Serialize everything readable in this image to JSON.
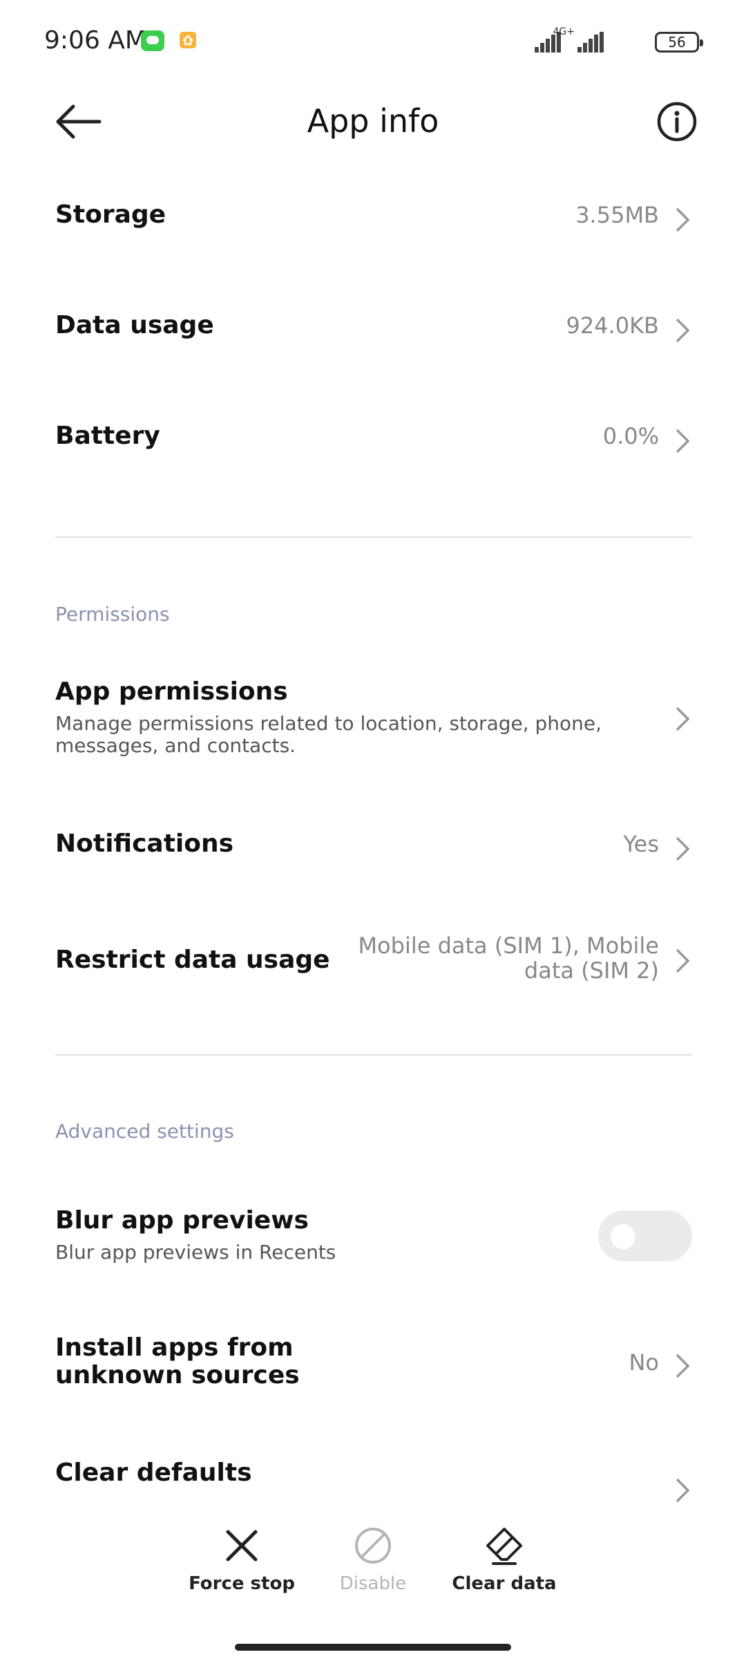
{
  "status_bar": {
    "time": "9:06 AM",
    "network_type": "4G+",
    "battery_level": "56"
  },
  "header": {
    "title": "App info"
  },
  "rows_top": [
    {
      "label": "Storage",
      "value": "3.55MB"
    },
    {
      "label": "Data usage",
      "value": "924.0KB"
    },
    {
      "label": "Battery",
      "value": "0.0%"
    }
  ],
  "permissions": {
    "section_title": "Permissions",
    "app_permissions": {
      "label": "App permissions",
      "description": "Manage permissions related to location, storage, phone, messages, and contacts."
    },
    "notifications": {
      "label": "Notifications",
      "value": "Yes"
    },
    "restrict_data": {
      "label": "Restrict data usage",
      "value": "Mobile data (SIM 1), Mobile data (SIM 2)"
    }
  },
  "advanced": {
    "section_title": "Advanced settings",
    "blur_previews": {
      "label": "Blur app previews",
      "description": "Blur app previews in Recents",
      "enabled": false
    },
    "install_unknown": {
      "label": "Install apps from unknown sources",
      "value": "No"
    },
    "clear_defaults": {
      "label": "Clear defaults"
    }
  },
  "actions": {
    "force_stop": "Force stop",
    "disable": "Disable",
    "clear_data": "Clear data"
  },
  "icons": {
    "back": "arrow-left-icon",
    "info": "info-circle-icon",
    "chevron": "chevron-right-icon",
    "force_stop": "x-icon",
    "disable": "block-icon",
    "clear_data": "eraser-icon"
  },
  "colors": {
    "section_header": "#8a92b0",
    "value_text": "#888888",
    "toggle_off": "#ebebeb",
    "message_notification": "#3ccf4e"
  }
}
